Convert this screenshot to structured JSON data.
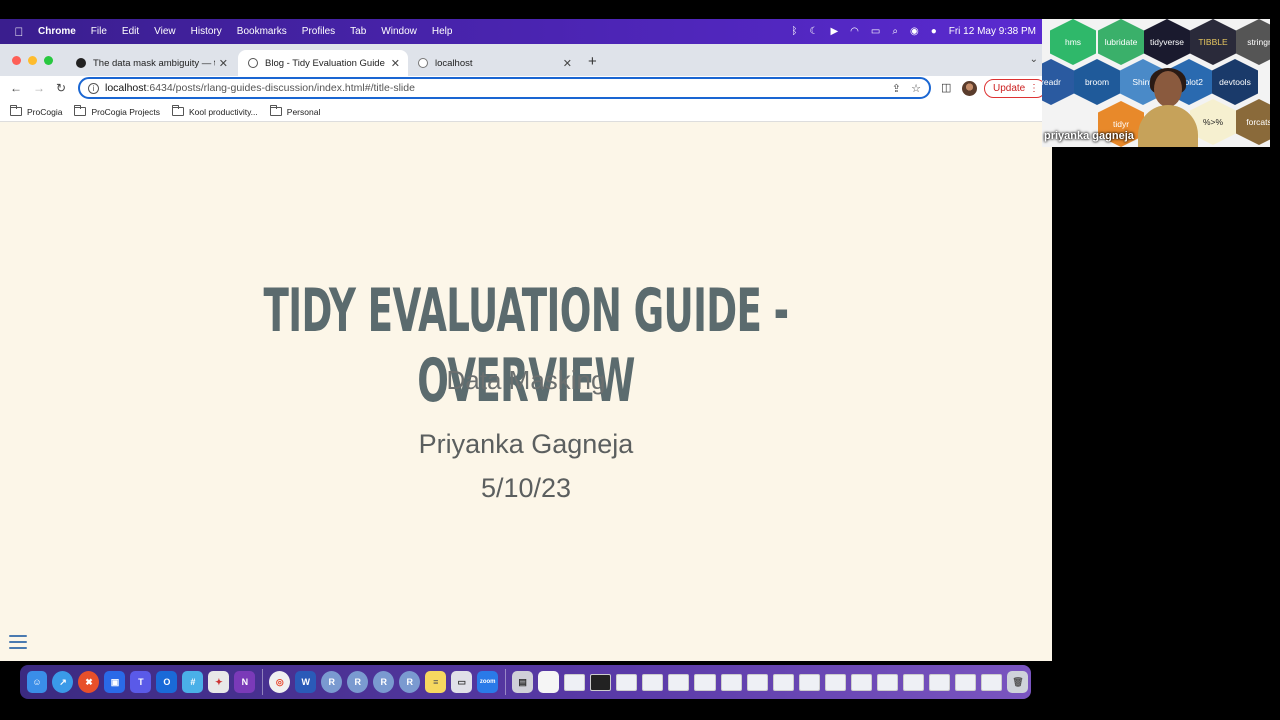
{
  "menubar": {
    "app": "Chrome",
    "items": [
      "File",
      "Edit",
      "View",
      "History",
      "Bookmarks",
      "Profiles",
      "Tab",
      "Window",
      "Help"
    ],
    "clock": "Fri 12 May  9:38 PM"
  },
  "tabs": [
    {
      "title": "The data mask ambiguity — top",
      "active": false
    },
    {
      "title": "Blog - Tidy Evaluation Guide -",
      "active": true
    },
    {
      "title": "localhost",
      "active": false
    }
  ],
  "address": {
    "host": "localhost",
    "path": ":6434/posts/rlang-guides-discussion/index.html#/title-slide"
  },
  "toolbar": {
    "update_label": "Update"
  },
  "bookmarks": [
    "ProCogia",
    "ProCogia Projects",
    "Kool productivity...",
    "Personal"
  ],
  "slide": {
    "title": "TIDY EVALUATION GUIDE - OVERVIEW",
    "subtitle": "Data Masking",
    "author": "Priyanka Gagneja",
    "date": "5/10/23"
  },
  "video": {
    "participant_name": "priyanka gagneja",
    "hex_stickers": [
      "hms",
      "lubridate",
      "tidyverse",
      "TIBBLE",
      "stringr",
      "readr",
      "broom",
      "Shiny",
      "ggplot2",
      "devtools",
      "tidyr",
      "%>%",
      "forcats"
    ]
  },
  "colors": {
    "menubar": "#4a24b0",
    "slide_bg": "#fcf6e8",
    "title": "#5b6b6e",
    "omnibox_border": "#1a66d2",
    "update": "#cc2222"
  }
}
